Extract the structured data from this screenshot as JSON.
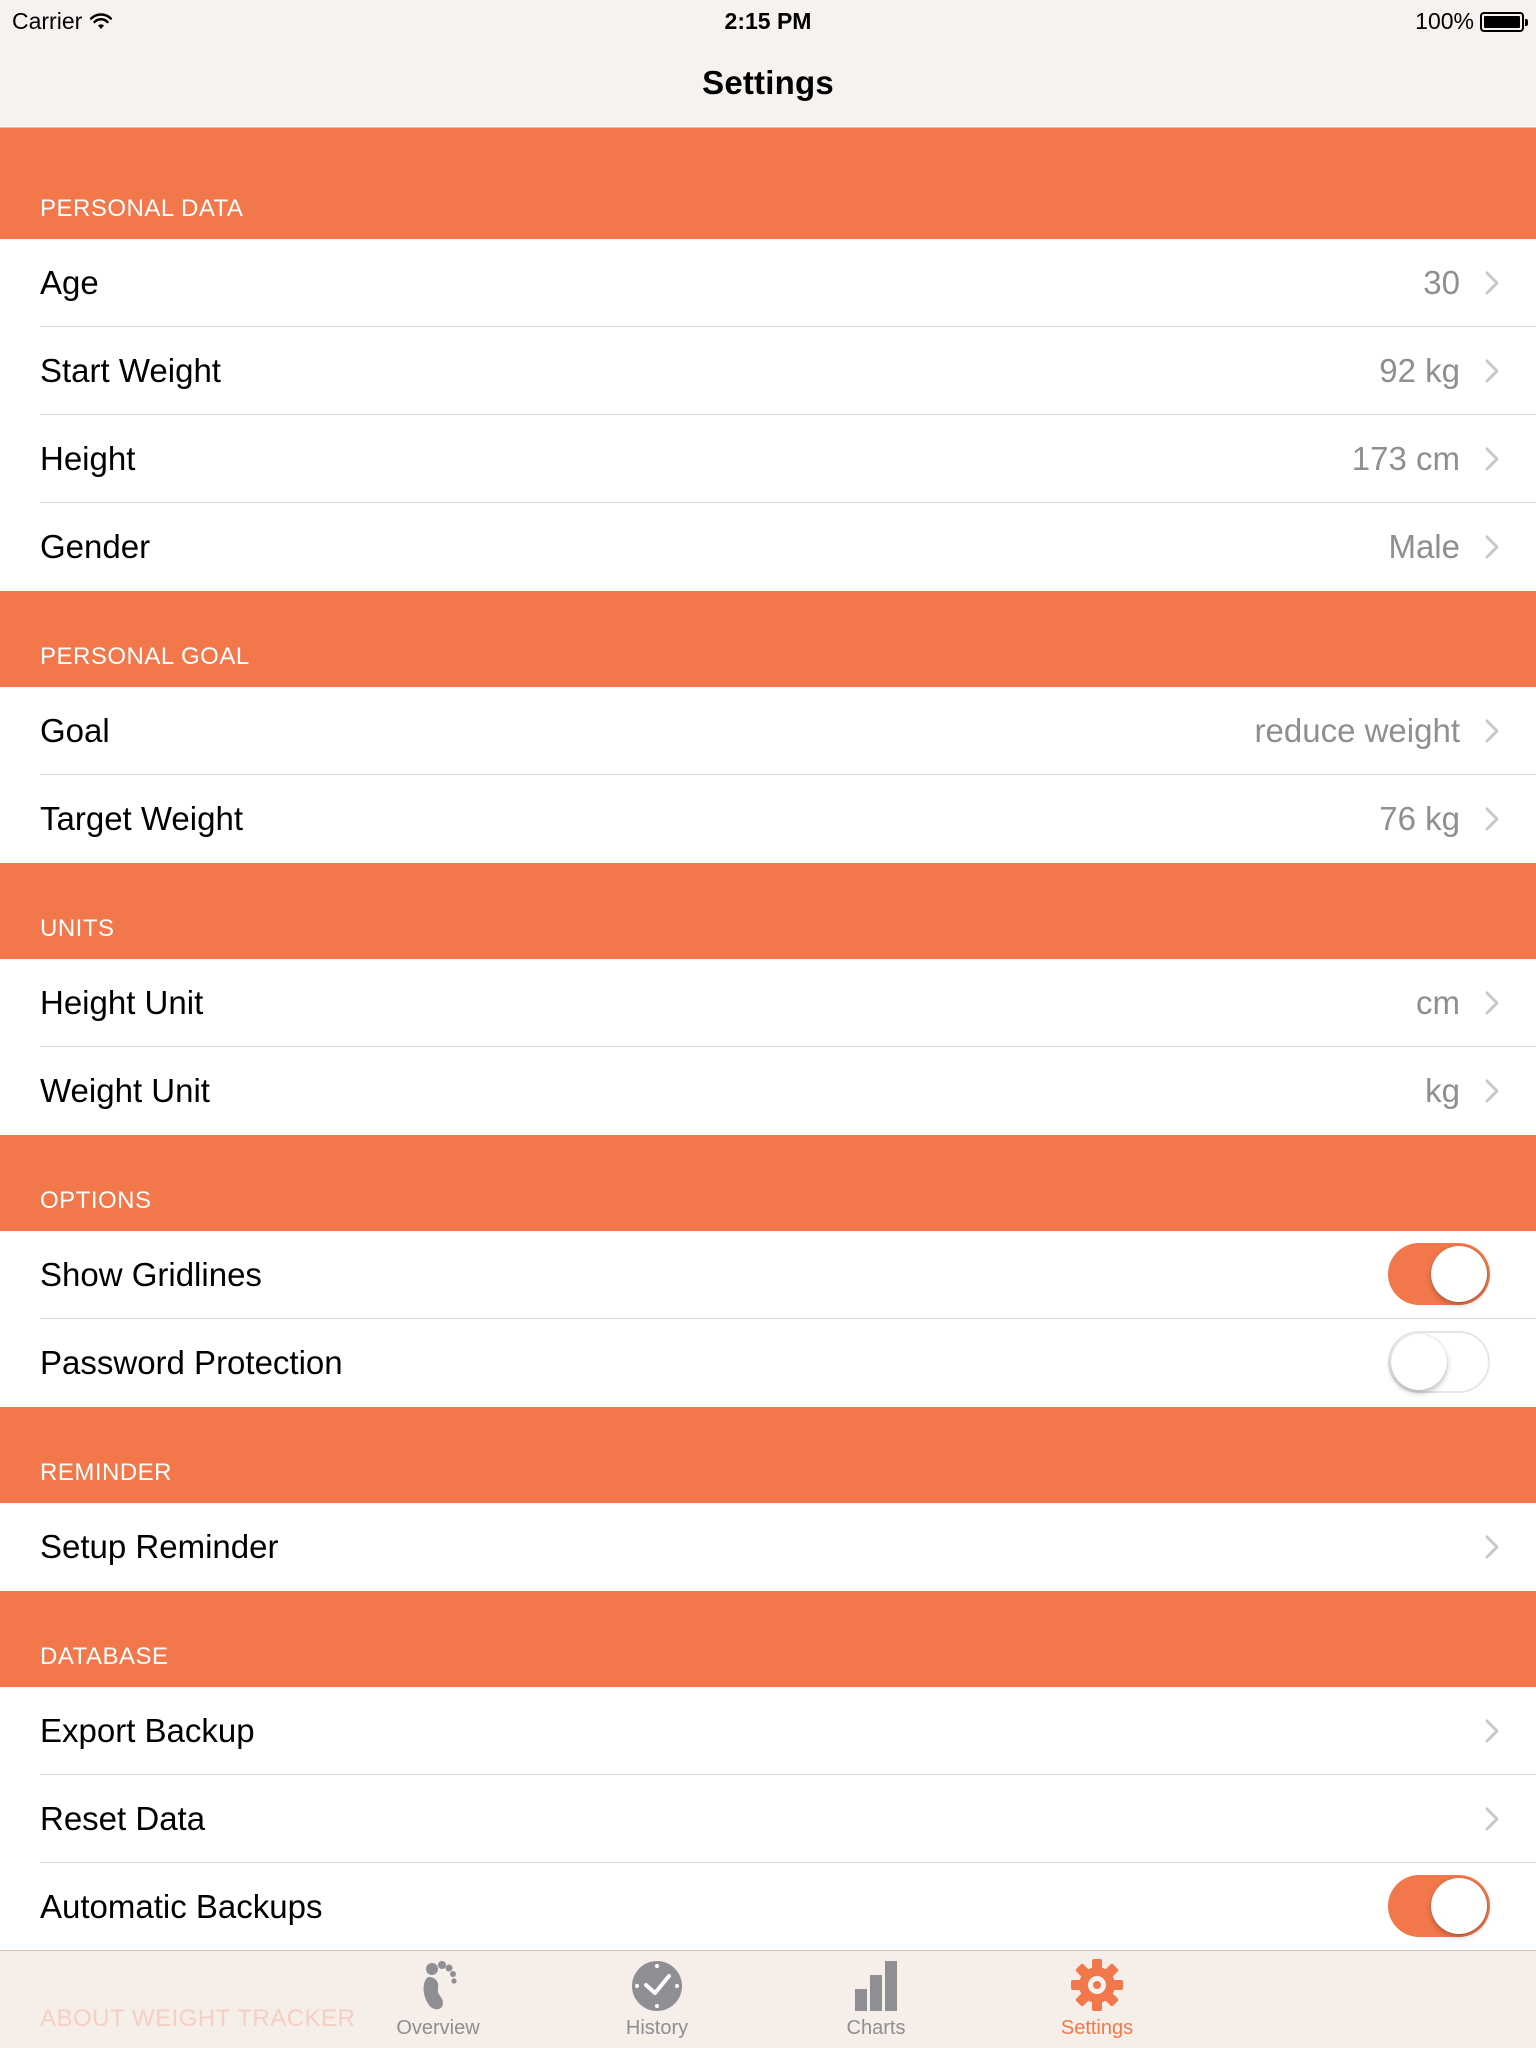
{
  "status_bar": {
    "carrier": "Carrier",
    "time": "2:15 PM",
    "battery": "100%"
  },
  "nav": {
    "title": "Settings"
  },
  "sections": {
    "personal_data": {
      "header": "PERSONAL DATA",
      "rows": [
        {
          "label": "Age",
          "value": "30"
        },
        {
          "label": "Start Weight",
          "value": "92 kg"
        },
        {
          "label": "Height",
          "value": "173 cm"
        },
        {
          "label": "Gender",
          "value": "Male"
        }
      ]
    },
    "personal_goal": {
      "header": "PERSONAL GOAL",
      "rows": [
        {
          "label": "Goal",
          "value": "reduce weight"
        },
        {
          "label": "Target Weight",
          "value": "76 kg"
        }
      ]
    },
    "units": {
      "header": "UNITS",
      "rows": [
        {
          "label": "Height Unit",
          "value": "cm"
        },
        {
          "label": "Weight Unit",
          "value": "kg"
        }
      ]
    },
    "options": {
      "header": "OPTIONS",
      "rows": [
        {
          "label": "Show Gridlines",
          "toggle": "on"
        },
        {
          "label": "Password Protection",
          "toggle": "off"
        }
      ]
    },
    "reminder": {
      "header": "REMINDER",
      "rows": [
        {
          "label": "Setup Reminder"
        }
      ]
    },
    "database": {
      "header": "DATABASE",
      "rows": [
        {
          "label": "Export Backup"
        },
        {
          "label": "Reset Data"
        },
        {
          "label": "Automatic Backups",
          "toggle": "on"
        }
      ]
    },
    "about": {
      "header": "ABOUT WEIGHT TRACKER"
    }
  },
  "tabbar": {
    "tabs": [
      {
        "label": "Overview",
        "icon": "footprint-icon"
      },
      {
        "label": "History",
        "icon": "clock-icon"
      },
      {
        "label": "Charts",
        "icon": "bar-chart-icon"
      },
      {
        "label": "Settings",
        "icon": "gear-icon",
        "active": true
      }
    ]
  },
  "colors": {
    "accent": "#f2784b",
    "value_gray": "#8e8e93",
    "nav_bg": "#f6f2ef"
  }
}
